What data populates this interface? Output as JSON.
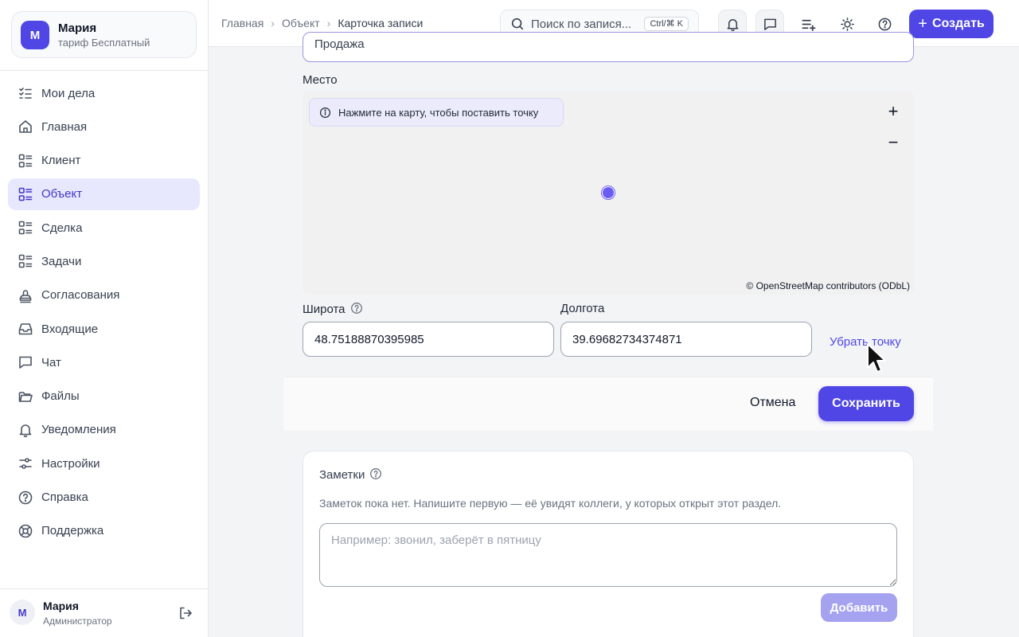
{
  "account": {
    "avatar_letter": "М",
    "name": "Мария",
    "plan": "тариф Бесплатный"
  },
  "sidebar": {
    "items": [
      {
        "label": "Мои дела",
        "icon": "checklist-icon"
      },
      {
        "label": "Главная",
        "icon": "home-icon"
      },
      {
        "label": "Клиент",
        "icon": "grid-list-icon"
      },
      {
        "label": "Объект",
        "icon": "grid-list-icon",
        "active": true
      },
      {
        "label": "Сделка",
        "icon": "grid-list-icon"
      },
      {
        "label": "Задачи",
        "icon": "grid-list-icon"
      },
      {
        "label": "Согласования",
        "icon": "stamp-icon"
      },
      {
        "label": "Входящие",
        "icon": "inbox-icon"
      },
      {
        "label": "Чат",
        "icon": "chat-icon"
      },
      {
        "label": "Файлы",
        "icon": "folder-icon"
      },
      {
        "label": "Уведомления",
        "icon": "bell-icon"
      },
      {
        "label": "Настройки",
        "icon": "sliders-icon"
      },
      {
        "label": "Справка",
        "icon": "help-circle-icon"
      },
      {
        "label": "Поддержка",
        "icon": "lifebuoy-icon"
      }
    ]
  },
  "user": {
    "avatar_letter": "М",
    "name": "Мария",
    "role": "Администратор"
  },
  "breadcrumb": [
    "Главная",
    "Объект",
    "Карточка записи"
  ],
  "search": {
    "placeholder": "Поиск по записям",
    "placeholder_shown": "Поиск по запися...",
    "shortcut": "Ctrl/⌘ K"
  },
  "toolbar": {
    "create_label": "Создать"
  },
  "form": {
    "previous_field_value": "Продажа",
    "place_label": "Место",
    "map": {
      "hint": "Нажмите на карту, чтобы поставить точку",
      "zoom_in": "+",
      "zoom_out": "−",
      "attribution": "© OpenStreetMap contributors (ODbL)"
    },
    "latitude": {
      "label": "Широта",
      "value": "48.75188870395985"
    },
    "longitude": {
      "label": "Долгота",
      "value": "39.69682734374871"
    },
    "remove_point_label": "Убрать точку",
    "cancel_label": "Отмена",
    "save_label": "Сохранить"
  },
  "notes": {
    "title": "Заметки",
    "empty_text": "Заметок пока нет. Напишите первую — её увидят коллеги, у которых открыт этот раздел.",
    "placeholder": "Например: звонил, заберёт в пятницу",
    "add_label": "Добавить"
  },
  "colors": {
    "accent": "#4f46e5",
    "active_nav_bg": "#e7e7fd",
    "marker": "#6b5cf0"
  }
}
